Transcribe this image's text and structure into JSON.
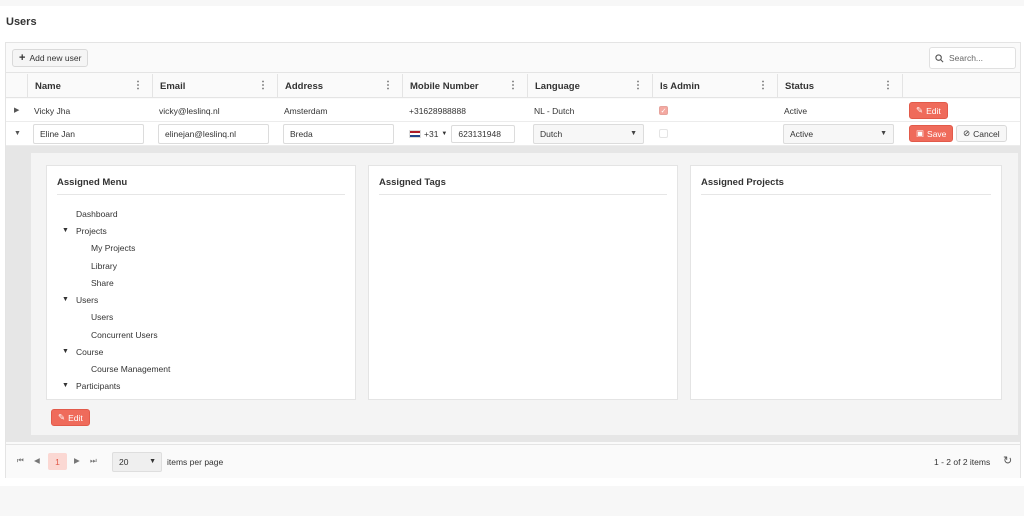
{
  "page": {
    "title": "Users"
  },
  "toolbar": {
    "add_label": "Add new user",
    "search_placeholder": "Search..."
  },
  "columns": [
    {
      "label": "Name"
    },
    {
      "label": "Email"
    },
    {
      "label": "Address"
    },
    {
      "label": "Mobile Number"
    },
    {
      "label": "Language"
    },
    {
      "label": "Is Admin"
    },
    {
      "label": "Status"
    }
  ],
  "rows": [
    {
      "name": "Vicky Jha",
      "email": "vicky@leslinq.nl",
      "address": "Amsterdam",
      "mobile": "+31628988888",
      "language": "NL - Dutch",
      "is_admin": true,
      "status": "Active",
      "edit_label": "Edit"
    },
    {
      "name": "Eline Jan",
      "email": "elinejan@leslinq.nl",
      "address": "Breda",
      "country_code": "+31",
      "mobile": "623131948",
      "language": "Dutch",
      "is_admin": false,
      "status": "Active",
      "save_label": "Save",
      "cancel_label": "Cancel"
    }
  ],
  "detail": {
    "assigned_menu": {
      "title": "Assigned Menu",
      "items": [
        "Dashboard",
        "Projects",
        "My Projects",
        "Library",
        "Share",
        "Users",
        "Users",
        "Concurrent Users",
        "Course",
        "Course Management",
        "Participants"
      ]
    },
    "assigned_tags": {
      "title": "Assigned Tags"
    },
    "assigned_projects": {
      "title": "Assigned Projects"
    },
    "edit_label": "Edit"
  },
  "pager": {
    "current_page": "1",
    "page_size": "20",
    "per_page_label": "items per page",
    "info": "1 - 2 of 2 items"
  },
  "colors": {
    "accent": "#ef6b5b",
    "accent_light": "#fbd8d3"
  }
}
